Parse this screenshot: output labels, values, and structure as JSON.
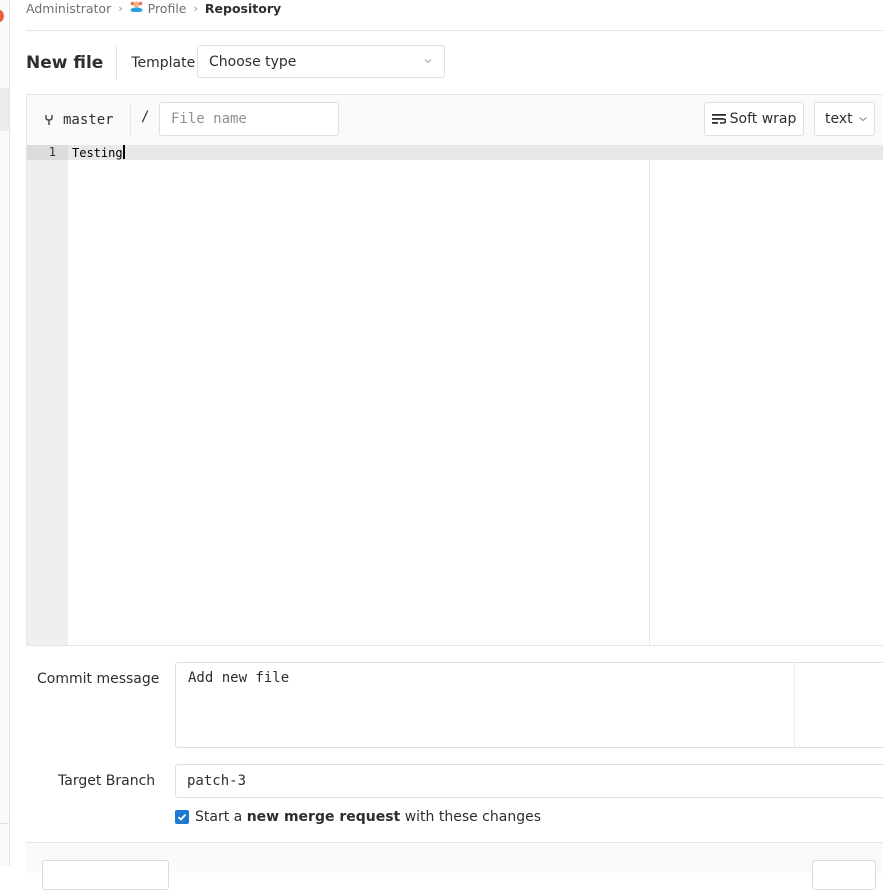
{
  "breadcrumb": {
    "items": [
      "Administrator",
      "Profile",
      "Repository"
    ],
    "separator": "›"
  },
  "header": {
    "title": "New file",
    "template_label": "Template",
    "template_select_value": "Choose type"
  },
  "editor": {
    "branch": "master",
    "path_separator": "/",
    "file_name_value": "",
    "file_name_placeholder": "File name",
    "soft_wrap_label": "Soft wrap",
    "mode_label": "text",
    "lines": [
      {
        "number": "1",
        "text": "Testing"
      }
    ]
  },
  "form": {
    "commit_message_label": "Commit message",
    "commit_message_value": "Add new file",
    "target_branch_label": "Target Branch",
    "target_branch_value": "patch-3",
    "merge_request_checked": true,
    "merge_request_prefix": "Start a ",
    "merge_request_bold": "new merge request",
    "merge_request_suffix": " with these changes"
  },
  "colors": {
    "accent": "#1f78d1",
    "badge": "#e75e40"
  }
}
